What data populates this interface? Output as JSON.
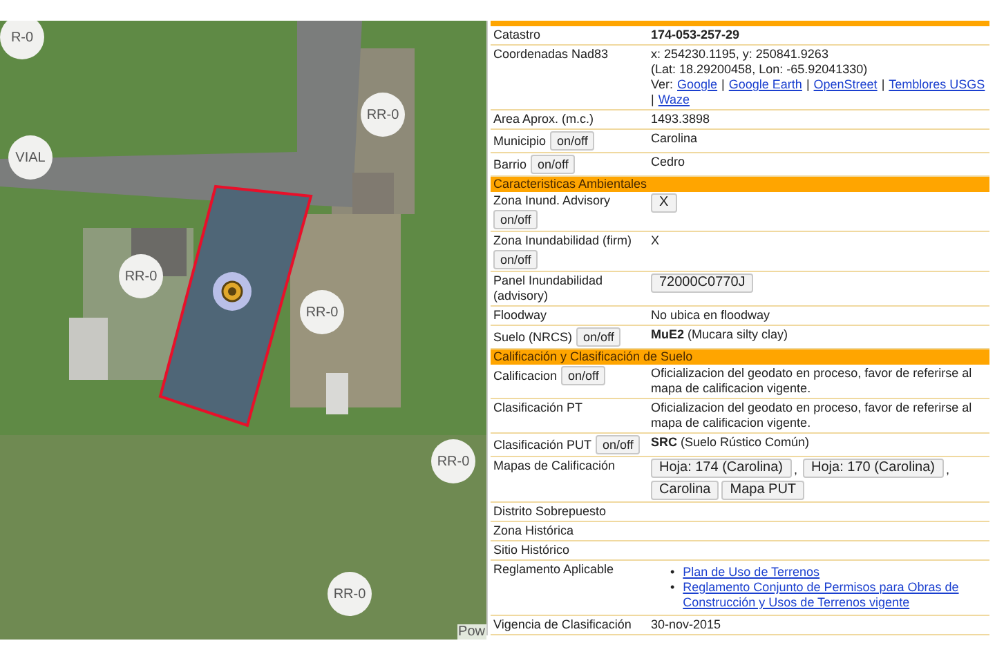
{
  "map": {
    "labels": [
      {
        "text": "R-0"
      },
      {
        "text": "RR-0"
      },
      {
        "text": "VIAL"
      },
      {
        "text": "RR-0"
      },
      {
        "text": "RR-0"
      },
      {
        "text": "RR-0"
      },
      {
        "text": "RR-0"
      }
    ],
    "attribution": "Pow"
  },
  "panel": {
    "sections": [
      {
        "rows": [
          {
            "label": "Catastro",
            "kind": "bold",
            "value": "174-053-257-29"
          },
          {
            "label": "Coordenadas Nad83",
            "kind": "coords",
            "lines": [
              "x: 254230.1195, y: 250841.9263",
              "(Lat: 18.29200458, Lon: -65.92041330)"
            ],
            "prefix": "Ver:",
            "links": [
              {
                "text": "Google",
                "sep": "|"
              },
              {
                "text": "Google Earth",
                "sep": "|"
              },
              {
                "text": "OpenStreet",
                "sep": "|"
              },
              {
                "text": "Temblores USGS",
                "sep": "|"
              },
              {
                "text": "Waze"
              }
            ]
          },
          {
            "label": "Area Aprox. (m.c.)",
            "kind": "text",
            "value": "1493.3898"
          },
          {
            "label": "Municipio",
            "toggle": "on/off",
            "kind": "text",
            "value": "Carolina"
          },
          {
            "label": "Barrio",
            "toggle": "on/off",
            "kind": "text",
            "value": "Cedro"
          }
        ]
      },
      {
        "title": "Caracteristicas Ambientales",
        "rows": [
          {
            "label": "Zona Inund. Advisory",
            "toggle": "on/off",
            "kind": "buttons",
            "buttons": [
              {
                "text": "X"
              }
            ]
          },
          {
            "label": "Zona Inundabilidad (firm)",
            "toggle": "on/off",
            "kind": "text",
            "value": "X"
          },
          {
            "label": "Panel Inundabilidad (advisory)",
            "kind": "buttons",
            "buttons": [
              {
                "text": "72000C0770J"
              }
            ]
          },
          {
            "label": "Floodway",
            "kind": "text",
            "value": "No ubica en floodway"
          },
          {
            "label": "Suelo (NRCS)",
            "toggle": "on/off",
            "kind": "text",
            "value": "**MuE2** (Mucara silty clay)"
          }
        ]
      },
      {
        "title": "Calificación y Clasificación de Suelo",
        "rows": [
          {
            "label": "Calificacion",
            "toggle": "on/off",
            "kind": "text",
            "value": "Oficializacion del geodato en proceso, favor de referirse al mapa de calificacion vigente."
          },
          {
            "label": "Clasificación PT",
            "kind": "text",
            "value": "Oficializacion del geodato en proceso, favor de referirse al mapa de calificacion vigente."
          },
          {
            "label": "Clasificación PUT",
            "toggle": "on/off",
            "kind": "text",
            "value": "**SRC** (Suelo Rústico Común)"
          },
          {
            "label": "Mapas de Calificación",
            "kind": "buttons",
            "buttons": [
              {
                "text": "Hoja: 174 (Carolina)",
                "sep": ","
              },
              {
                "text": "Hoja: 170 (Carolina)",
                "sep": ","
              },
              {
                "text": "Carolina"
              },
              {
                "text": "Mapa PUT"
              }
            ]
          },
          {
            "label": "Distrito Sobrepuesto",
            "kind": "empty"
          },
          {
            "label": "Zona Histórica",
            "kind": "empty"
          },
          {
            "label": "Sitio Histórico",
            "kind": "empty"
          },
          {
            "label": "Reglamento Aplicable",
            "kind": "linklist",
            "links": [
              {
                "bullet": "•",
                "text": "Plan de Uso de Terrenos"
              },
              {
                "bullet": "•",
                "text": "Reglamento Conjunto de Permisos para Obras de Construcción y Usos de Terrenos vigente"
              }
            ]
          },
          {
            "label": "Vigencia de Clasificación",
            "kind": "text",
            "value": "30-nov-2015"
          }
        ]
      }
    ]
  }
}
